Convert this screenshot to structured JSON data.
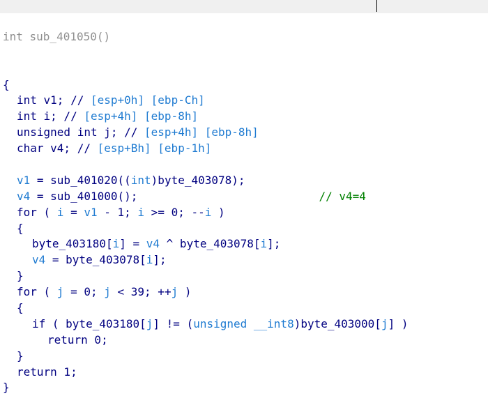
{
  "editor": {
    "title_line": "int sub_401050()",
    "lines": [
      {
        "indent": 0,
        "tokens": [
          {
            "t": "{",
            "c": "code"
          }
        ]
      },
      {
        "indent": 1,
        "tokens": [
          {
            "t": "int v1; // ",
            "c": "code"
          },
          {
            "t": "[esp+0h] [ebp-Ch]",
            "c": "cmt"
          }
        ]
      },
      {
        "indent": 1,
        "tokens": [
          {
            "t": "int i; // ",
            "c": "code"
          },
          {
            "t": "[esp+4h] [ebp-8h]",
            "c": "cmt"
          }
        ]
      },
      {
        "indent": 1,
        "tokens": [
          {
            "t": "unsigned int j; // ",
            "c": "code"
          },
          {
            "t": "[esp+4h] [ebp-8h]",
            "c": "cmt"
          }
        ]
      },
      {
        "indent": 1,
        "tokens": [
          {
            "t": "char v4; // ",
            "c": "code"
          },
          {
            "t": "[esp+Bh] [ebp-1h]",
            "c": "cmt"
          }
        ]
      },
      {
        "indent": 0,
        "tokens": [
          {
            "t": "",
            "c": "code"
          }
        ]
      },
      {
        "indent": 1,
        "tokens": [
          {
            "t": "v1",
            "c": "var"
          },
          {
            "t": " = sub_401020((",
            "c": "code"
          },
          {
            "t": "int",
            "c": "var"
          },
          {
            "t": ")byte_403078);",
            "c": "code"
          }
        ]
      },
      {
        "indent": 1,
        "tokens": [
          {
            "t": "v4",
            "c": "var"
          },
          {
            "t": " = sub_401000();                           ",
            "c": "code"
          },
          {
            "t": "// v4=4",
            "c": "cmt-green"
          }
        ]
      },
      {
        "indent": 1,
        "tokens": [
          {
            "t": "for ( ",
            "c": "code"
          },
          {
            "t": "i",
            "c": "var"
          },
          {
            "t": " = ",
            "c": "code"
          },
          {
            "t": "v1",
            "c": "var"
          },
          {
            "t": " - 1; ",
            "c": "code"
          },
          {
            "t": "i",
            "c": "var"
          },
          {
            "t": " >= 0; --",
            "c": "code"
          },
          {
            "t": "i",
            "c": "var"
          },
          {
            "t": " )",
            "c": "code"
          }
        ]
      },
      {
        "indent": 1,
        "tokens": [
          {
            "t": "{",
            "c": "code"
          }
        ]
      },
      {
        "indent": 2,
        "tokens": [
          {
            "t": "byte_403180[",
            "c": "code"
          },
          {
            "t": "i",
            "c": "var"
          },
          {
            "t": "] = ",
            "c": "code"
          },
          {
            "t": "v4",
            "c": "var"
          },
          {
            "t": " ^ byte_403078[",
            "c": "code"
          },
          {
            "t": "i",
            "c": "var"
          },
          {
            "t": "];",
            "c": "code"
          }
        ]
      },
      {
        "indent": 2,
        "tokens": [
          {
            "t": "v4",
            "c": "var"
          },
          {
            "t": " = byte_403078[",
            "c": "code"
          },
          {
            "t": "i",
            "c": "var"
          },
          {
            "t": "];",
            "c": "code"
          }
        ]
      },
      {
        "indent": 1,
        "tokens": [
          {
            "t": "}",
            "c": "code"
          }
        ]
      },
      {
        "indent": 1,
        "tokens": [
          {
            "t": "for ( ",
            "c": "code"
          },
          {
            "t": "j",
            "c": "var"
          },
          {
            "t": " = 0; ",
            "c": "code"
          },
          {
            "t": "j",
            "c": "var"
          },
          {
            "t": " < 39; ++",
            "c": "code"
          },
          {
            "t": "j",
            "c": "var"
          },
          {
            "t": " )",
            "c": "code"
          }
        ]
      },
      {
        "indent": 1,
        "tokens": [
          {
            "t": "{",
            "c": "code"
          }
        ]
      },
      {
        "indent": 2,
        "tokens": [
          {
            "t": "if ( byte_403180[",
            "c": "code"
          },
          {
            "t": "j",
            "c": "var"
          },
          {
            "t": "] != (",
            "c": "code"
          },
          {
            "t": "unsigned __int8",
            "c": "var"
          },
          {
            "t": ")byte_403000[",
            "c": "code"
          },
          {
            "t": "j",
            "c": "var"
          },
          {
            "t": "] )",
            "c": "code"
          }
        ]
      },
      {
        "indent": 3,
        "tokens": [
          {
            "t": "return 0;",
            "c": "code"
          }
        ]
      },
      {
        "indent": 1,
        "tokens": [
          {
            "t": "}",
            "c": "code"
          }
        ]
      },
      {
        "indent": 1,
        "tokens": [
          {
            "t": "return 1;",
            "c": "code"
          }
        ]
      },
      {
        "indent": 0,
        "tokens": [
          {
            "t": "}",
            "c": "code"
          }
        ]
      }
    ]
  }
}
